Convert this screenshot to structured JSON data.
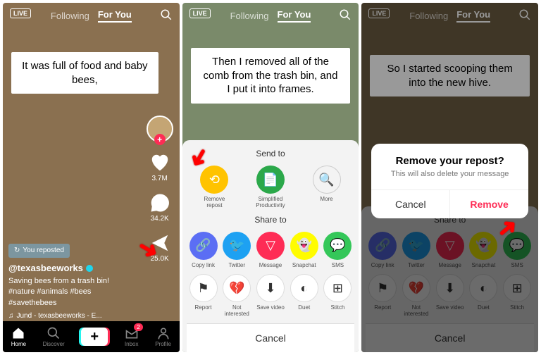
{
  "topbar": {
    "live": "LIVE",
    "following": "Following",
    "foryou": "For You"
  },
  "p1": {
    "caption": "It was full of food and baby bees,",
    "likes": "3.7M",
    "comments": "34.2K",
    "shares": "25.0K",
    "reposted": "You reposted",
    "username": "@texasbeeworks",
    "desc": "Saving bees from a trash bin! #nature #animals #bees #savethebees",
    "music": "Jund - texasbeeworks - E..."
  },
  "p2": {
    "caption": "Then I removed all of the comb from the trash bin, and I put it into frames."
  },
  "p3": {
    "caption": "So I started scooping them into the new hive."
  },
  "sheet": {
    "sendto": "Send to",
    "shareto": "Share to",
    "cancel": "Cancel",
    "removeRepost": "Remove repost",
    "simplified": "Simplified Productivity",
    "more": "More",
    "copylink": "Copy link",
    "twitter": "Twitter",
    "message": "Message",
    "snapchat": "Snapchat",
    "sms": "SMS",
    "report": "Report",
    "notint": "Not interested",
    "savevid": "Save video",
    "duet": "Duet",
    "stitch": "Stitch"
  },
  "dialog": {
    "title": "Remove your repost?",
    "msg": "This will also delete your message",
    "cancel": "Cancel",
    "remove": "Remove"
  },
  "tabbar": {
    "home": "Home",
    "discover": "Discover",
    "inbox": "Inbox",
    "profile": "Profile",
    "badge": "2"
  }
}
